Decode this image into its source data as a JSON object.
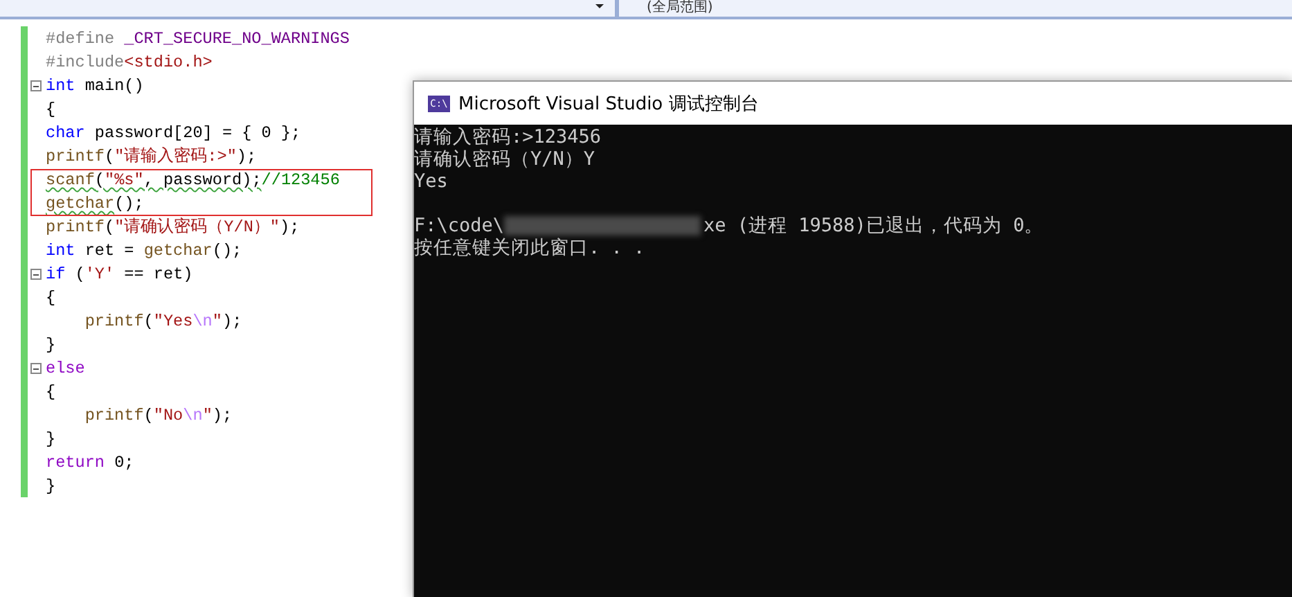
{
  "top_bar": {
    "scope": "(全局范围)"
  },
  "editor": {
    "lines": [
      {
        "fold": false,
        "boxed": false,
        "tokens": [
          {
            "kind": "pre",
            "text": "#define "
          },
          {
            "kind": "macro",
            "text": "_CRT_SECURE_NO_WARNINGS"
          }
        ]
      },
      {
        "fold": false,
        "boxed": false,
        "tokens": [
          {
            "kind": "pre",
            "text": "#include"
          },
          {
            "kind": "str",
            "text": "<stdio.h>"
          }
        ]
      },
      {
        "fold": true,
        "boxed": false,
        "tokens": [
          {
            "kind": "kw",
            "text": "int"
          },
          {
            "kind": "plain",
            "text": " main()"
          }
        ]
      },
      {
        "fold": false,
        "boxed": false,
        "tokens": [
          {
            "kind": "plain",
            "text": "{"
          }
        ]
      },
      {
        "fold": false,
        "boxed": false,
        "tokens": [
          {
            "kind": "kw",
            "text": "char"
          },
          {
            "kind": "plain",
            "text": " password[20] = { 0 };"
          }
        ]
      },
      {
        "fold": false,
        "boxed": false,
        "tokens": [
          {
            "kind": "fn",
            "text": "printf"
          },
          {
            "kind": "plain",
            "text": "("
          },
          {
            "kind": "str",
            "text": "\"请输入密码:>\""
          },
          {
            "kind": "plain",
            "text": ");"
          }
        ]
      },
      {
        "fold": false,
        "boxed": true,
        "tokens": [
          {
            "kind": "fn",
            "text": "scanf",
            "squiggle": true
          },
          {
            "kind": "plain",
            "text": "(",
            "squiggle": true
          },
          {
            "kind": "str",
            "text": "\"%s\"",
            "squiggle": true
          },
          {
            "kind": "plain",
            "text": ", password);",
            "squiggle": true
          },
          {
            "kind": "comment",
            "text": "//123456"
          }
        ]
      },
      {
        "fold": false,
        "boxed": true,
        "tokens": [
          {
            "kind": "fn",
            "text": "getchar",
            "squiggle": true
          },
          {
            "kind": "plain",
            "text": "();"
          }
        ]
      },
      {
        "fold": false,
        "boxed": false,
        "tokens": [
          {
            "kind": "fn",
            "text": "printf"
          },
          {
            "kind": "plain",
            "text": "("
          },
          {
            "kind": "str",
            "text": "\"请确认密码（Y/N）\""
          },
          {
            "kind": "plain",
            "text": ");"
          }
        ]
      },
      {
        "fold": false,
        "boxed": false,
        "tokens": [
          {
            "kind": "kw",
            "text": "int"
          },
          {
            "kind": "plain",
            "text": " ret = "
          },
          {
            "kind": "fn",
            "text": "getchar"
          },
          {
            "kind": "plain",
            "text": "();"
          }
        ]
      },
      {
        "fold": true,
        "boxed": false,
        "tokens": [
          {
            "kind": "kw",
            "text": "if"
          },
          {
            "kind": "plain",
            "text": " ("
          },
          {
            "kind": "str",
            "text": "'Y'"
          },
          {
            "kind": "plain",
            "text": " == ret)"
          }
        ]
      },
      {
        "fold": false,
        "boxed": false,
        "tokens": [
          {
            "kind": "plain",
            "text": "{"
          }
        ]
      },
      {
        "fold": false,
        "boxed": false,
        "tokens": [
          {
            "kind": "fn",
            "text": "    printf"
          },
          {
            "kind": "plain",
            "text": "("
          },
          {
            "kind": "str",
            "text": "\"Yes"
          },
          {
            "kind": "esc",
            "text": "\\n"
          },
          {
            "kind": "str",
            "text": "\""
          },
          {
            "kind": "plain",
            "text": ");"
          }
        ]
      },
      {
        "fold": false,
        "boxed": false,
        "tokens": [
          {
            "kind": "plain",
            "text": "}"
          }
        ]
      },
      {
        "fold": true,
        "boxed": false,
        "tokens": [
          {
            "kind": "ctl",
            "text": "else"
          }
        ]
      },
      {
        "fold": false,
        "boxed": false,
        "tokens": [
          {
            "kind": "plain",
            "text": "{"
          }
        ]
      },
      {
        "fold": false,
        "boxed": false,
        "tokens": [
          {
            "kind": "fn",
            "text": "    printf"
          },
          {
            "kind": "plain",
            "text": "("
          },
          {
            "kind": "str",
            "text": "\"No"
          },
          {
            "kind": "esc",
            "text": "\\n"
          },
          {
            "kind": "str",
            "text": "\""
          },
          {
            "kind": "plain",
            "text": ");"
          }
        ]
      },
      {
        "fold": false,
        "boxed": false,
        "tokens": [
          {
            "kind": "plain",
            "text": "}"
          }
        ]
      },
      {
        "fold": false,
        "boxed": false,
        "tokens": [
          {
            "kind": "ctl",
            "text": "return"
          },
          {
            "kind": "plain",
            "text": " 0;"
          }
        ]
      },
      {
        "fold": false,
        "boxed": false,
        "tokens": [
          {
            "kind": "plain",
            "text": "}"
          }
        ]
      }
    ]
  },
  "console": {
    "title": "Microsoft Visual Studio 调试控制台",
    "icon_text": "C:\\",
    "lines": [
      {
        "parts": [
          {
            "kind": "text",
            "text": "请输入密码:>123456"
          }
        ]
      },
      {
        "parts": [
          {
            "kind": "text",
            "text": "请确认密码（Y/N）Y"
          }
        ]
      },
      {
        "parts": [
          {
            "kind": "text",
            "text": "Yes"
          }
        ]
      },
      {
        "blank_before": true,
        "parts": [
          {
            "kind": "text",
            "text": "F:\\code\\"
          },
          {
            "kind": "blur"
          },
          {
            "kind": "text",
            "text": "xe (进程 19588)已退出，代码为 0。"
          }
        ]
      },
      {
        "parts": [
          {
            "kind": "text",
            "text": "按任意键关闭此窗口. . ."
          }
        ]
      }
    ]
  }
}
